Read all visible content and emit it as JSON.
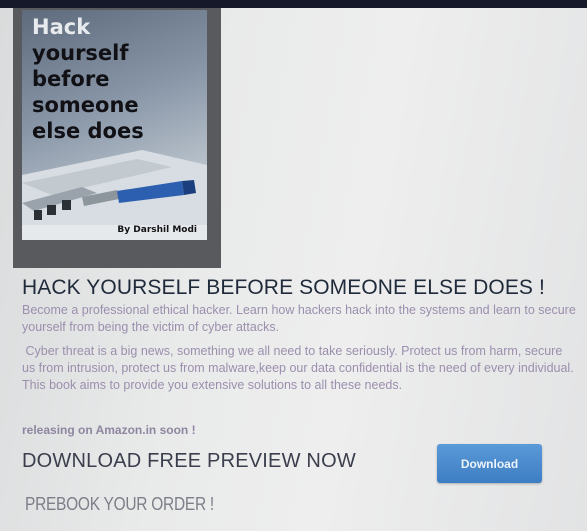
{
  "book": {
    "cover_title_first": "Hack",
    "cover_title_rest": "yourself\nbefore\nsomeone\nelse does",
    "author": "By Darshil Modi"
  },
  "page": {
    "headline": "HACK YOURSELF BEFORE SOMEONE ELSE DOES !",
    "paragraph1": "Become a professional ethical hacker. Learn how hackers hack into the systems and learn to secure yourself from being the victim of cyber attacks.",
    "paragraph2": "Cyber threat is a big news, something we all need to take seriously. Protect us from harm, secure us from intrusion, protect us from malware,keep our data confidential is the need of every individual. This book aims to provide you extensive solutions to all these needs.",
    "release_note": "releasing on Amazon.in soon !",
    "preview_text": "DOWNLOAD FREE PREVIEW NOW",
    "download_label": "Download",
    "prebook_text": "PREBOOK YOUR ORDER !"
  },
  "colors": {
    "button": "#4a8bce",
    "headline": "#1f2a3a",
    "body_text": "#9b8fad"
  }
}
